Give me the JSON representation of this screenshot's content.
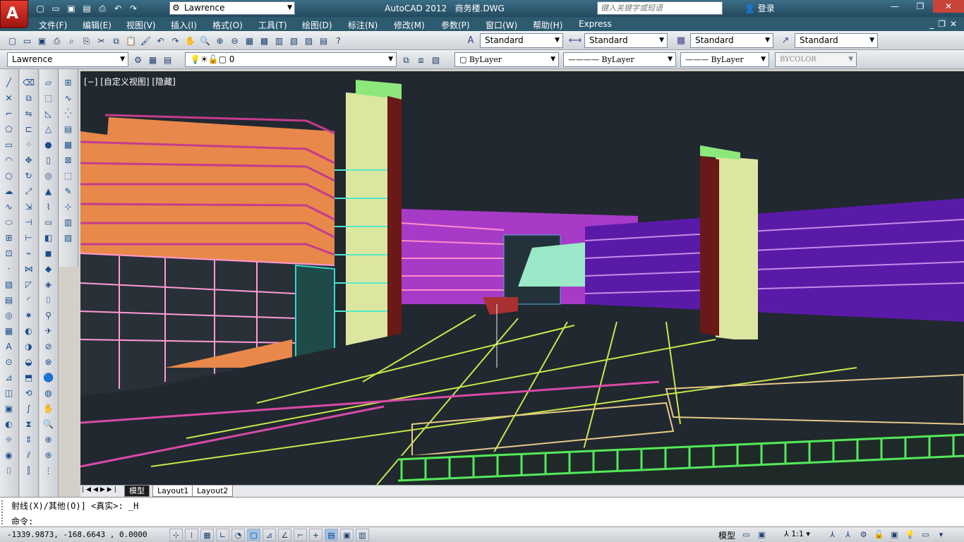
{
  "title": {
    "app": "AutoCAD 2012",
    "file": "商务楼.DWG",
    "workspace": "Lawrence",
    "search_placeholder": "键入关键字或短语",
    "login": "登录"
  },
  "menu": [
    "文件(F)",
    "编辑(E)",
    "视图(V)",
    "插入(I)",
    "格式(O)",
    "工具(T)",
    "绘图(D)",
    "标注(N)",
    "修改(M)",
    "参数(P)",
    "窗口(W)",
    "帮助(H)",
    "Express"
  ],
  "styles": {
    "text_style": "Standard",
    "dim_style": "Standard",
    "table_style": "Standard",
    "mleader_style": "Standard"
  },
  "layers": {
    "workspace": "Lawrence",
    "current_layer": "0",
    "color": "ByLayer",
    "linetype": "ByLayer",
    "lineweight": "ByLayer",
    "plotstyle": "BYCOLOR"
  },
  "viewport": {
    "label": "[−] [自定义视图] [隐藏]"
  },
  "tabs": [
    "模型",
    "Layout1",
    "Layout2"
  ],
  "command": {
    "history": "射线(X)/其他(O)] <真实>: _H",
    "prompt": "命令:"
  },
  "status": {
    "coords": "-1339.9873, -168.6643 , 0.0000",
    "model": "模型",
    "scale": "1:1"
  },
  "colors": {
    "titlebar": "#234a5e",
    "viewport_bg": "#212830",
    "accent_red": "#c9443a"
  }
}
